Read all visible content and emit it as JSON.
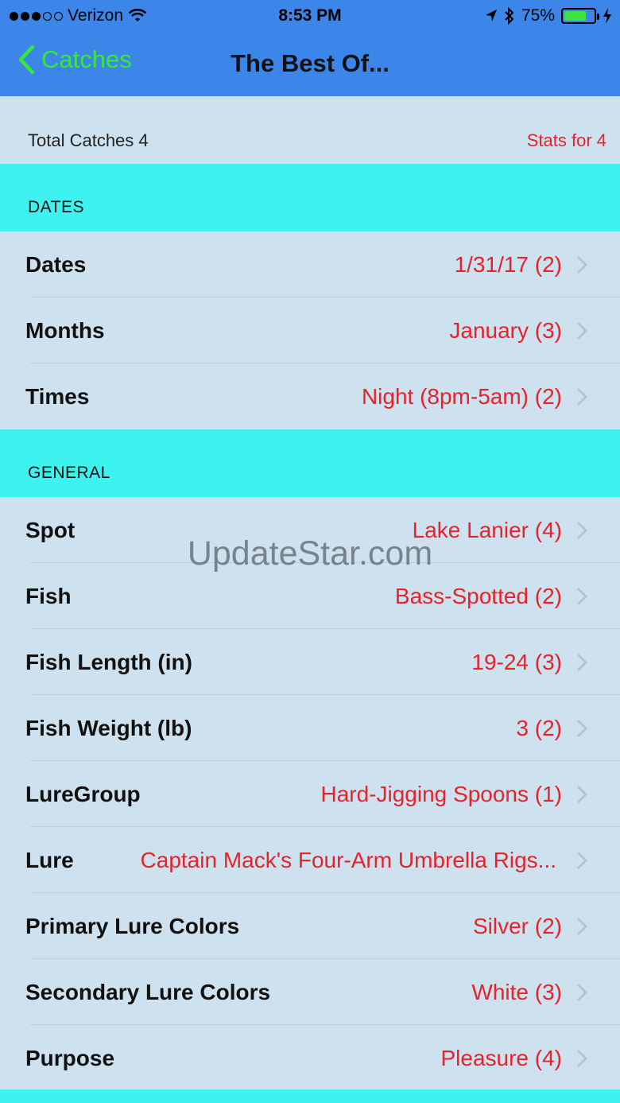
{
  "status_bar": {
    "carrier": "Verizon",
    "time": "8:53 PM",
    "battery": "75%",
    "signal_icon": "signal-dots-icon",
    "wifi_icon": "wifi-icon",
    "location_icon": "location-arrow-icon",
    "bluetooth_icon": "bluetooth-icon",
    "charging_icon": "charging-bolt-icon"
  },
  "nav": {
    "back_label": "Catches",
    "title": "The Best Of..."
  },
  "summary": {
    "total": "Total Catches 4",
    "stats": "Stats for 4"
  },
  "sections": {
    "dates": {
      "header": "DATES",
      "rows": [
        {
          "label": "Dates",
          "value": "1/31/17 (2)"
        },
        {
          "label": "Months",
          "value": "January (3)"
        },
        {
          "label": "Times",
          "value": "Night (8pm-5am) (2)"
        }
      ]
    },
    "general": {
      "header": "GENERAL",
      "rows": [
        {
          "label": "Spot",
          "value": "Lake Lanier (4)"
        },
        {
          "label": "Fish",
          "value": "Bass-Spotted (2)"
        },
        {
          "label": "Fish Length (in)",
          "value": "19-24 (3)"
        },
        {
          "label": "Fish Weight (lb)",
          "value": "3 (2)"
        },
        {
          "label": "LureGroup",
          "value": "Hard-Jigging Spoons (1)"
        },
        {
          "label": "Lure",
          "value": "Captain Mack's Four-Arm Umbrella Rigs..."
        },
        {
          "label": "Primary Lure Colors",
          "value": "Silver (2)"
        },
        {
          "label": "Secondary Lure Colors",
          "value": "White (3)"
        },
        {
          "label": "Purpose",
          "value": "Pleasure (4)"
        }
      ]
    }
  },
  "watermark": "UpdateStar.com",
  "colors": {
    "nav_bg": "#3b86e8",
    "back_green": "#39e63c",
    "section_cyan": "#3ef2f0",
    "row_bg": "#cde2ee",
    "value_red": "#e6222a"
  }
}
